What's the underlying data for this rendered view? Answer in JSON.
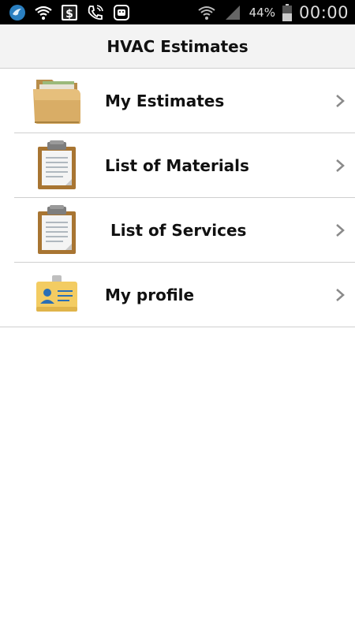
{
  "status_bar": {
    "icons": [
      "app-bird-icon",
      "wifi-question-icon",
      "dollar-app-icon",
      "phone-wifi-icon",
      "android-app-icon"
    ],
    "right_icons": [
      "wifi-icon",
      "signal-icon",
      "battery-icon"
    ],
    "battery_percent": "44%",
    "time": "00:00"
  },
  "header": {
    "title": "HVAC Estimates"
  },
  "menu": {
    "items": [
      {
        "label": "My Estimates",
        "icon": "folder-icon"
      },
      {
        "label": "List of Materials",
        "icon": "clipboard-icon"
      },
      {
        "label": " List of Services",
        "icon": "clipboard-icon"
      },
      {
        "label": "My profile",
        "icon": "id-card-icon"
      }
    ]
  },
  "colors": {
    "status_bar_bg": "#000000",
    "title_bar_bg": "#f3f3f3",
    "divider": "#cfcfcf",
    "chevron": "#8a8a8a"
  }
}
